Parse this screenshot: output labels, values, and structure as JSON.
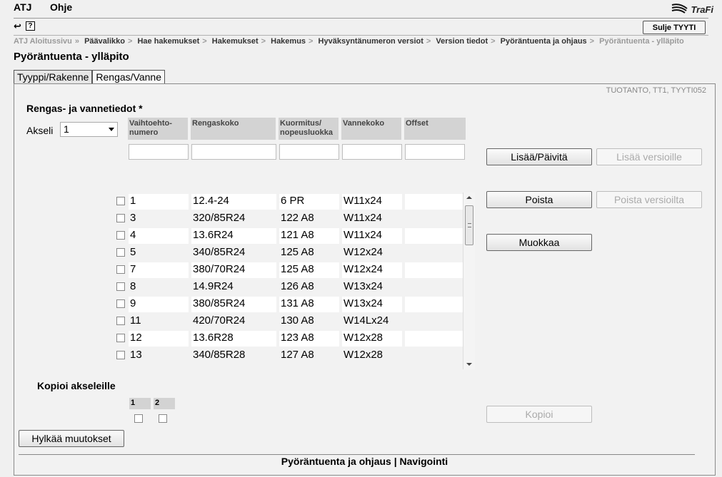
{
  "menu": {
    "atj": "ATJ",
    "help": "Ohje"
  },
  "brand": {
    "text": "TraFi"
  },
  "toolbar": {
    "back_icon": "back-arrow-icon",
    "help_label": "?"
  },
  "close_button": {
    "label": "Sulje TYYTI"
  },
  "breadcrumb": [
    {
      "label": "ATJ Aloitussivu",
      "muted": true
    },
    {
      "label": "Päävalikko",
      "muted": false
    },
    {
      "label": "Hae hakemukset",
      "muted": false
    },
    {
      "label": "Hakemukset",
      "muted": false
    },
    {
      "label": "Hakemus",
      "muted": false
    },
    {
      "label": "Hyväksyntänumeron versiot",
      "muted": false
    },
    {
      "label": "Version tiedot",
      "muted": false
    },
    {
      "label": "Pyöräntuenta ja ohjaus",
      "muted": false
    },
    {
      "label": "Pyöräntuenta - ylläpito",
      "muted": true
    }
  ],
  "page_title": "Pyöräntuenta - ylläpito",
  "tabs": [
    {
      "label": "Tyyppi/Rakenne",
      "active": false
    },
    {
      "label": "Rengas/Vanne",
      "active": true
    }
  ],
  "environment": "TUOTANTO, TT1, TYYTI052",
  "section_title": "Rengas- ja vannetiedot *",
  "akseli": {
    "label": "Akseli",
    "value": "1"
  },
  "columns": [
    {
      "label": "Vaihtoehto-numero"
    },
    {
      "label": "Rengaskoko"
    },
    {
      "label": "Kuormitus/ nopeusluokka"
    },
    {
      "label": "Vannekoko"
    },
    {
      "label": "Offset"
    }
  ],
  "buttons": {
    "add_update": "Lisää/Päivitä",
    "add_versions": "Lisää versioille",
    "delete": "Poista",
    "delete_versions": "Poista versioilta",
    "edit": "Muokkaa",
    "copy": "Kopioi",
    "discard": "Hylkää muutokset"
  },
  "rows": [
    {
      "num": "1",
      "tire": "12.4-24",
      "load": "6 PR",
      "rim": "W11x24",
      "offset": ""
    },
    {
      "num": "3",
      "tire": "320/85R24",
      "load": "122 A8",
      "rim": "W11x24",
      "offset": ""
    },
    {
      "num": "4",
      "tire": "13.6R24",
      "load": "121 A8",
      "rim": "W11x24",
      "offset": ""
    },
    {
      "num": "5",
      "tire": "340/85R24",
      "load": "125 A8",
      "rim": "W12x24",
      "offset": ""
    },
    {
      "num": "7",
      "tire": "380/70R24",
      "load": "125 A8",
      "rim": "W12x24",
      "offset": ""
    },
    {
      "num": "8",
      "tire": "14.9R24",
      "load": "126 A8",
      "rim": "W13x24",
      "offset": ""
    },
    {
      "num": "9",
      "tire": "380/85R24",
      "load": "131 A8",
      "rim": "W13x24",
      "offset": ""
    },
    {
      "num": "11",
      "tire": "420/70R24",
      "load": "130 A8",
      "rim": "W14Lx24",
      "offset": ""
    },
    {
      "num": "12",
      "tire": "13.6R28",
      "load": "123 A8",
      "rim": "W12x28",
      "offset": ""
    },
    {
      "num": "13",
      "tire": "340/85R28",
      "load": "127 A8",
      "rim": "W12x28",
      "offset": ""
    }
  ],
  "copy_axles": {
    "title": "Kopioi akseleille",
    "axles": [
      "1",
      "2"
    ]
  },
  "footer": {
    "link1": "Pyöräntuenta ja ohjaus",
    "separator": " | ",
    "link2": "Navigointi"
  }
}
